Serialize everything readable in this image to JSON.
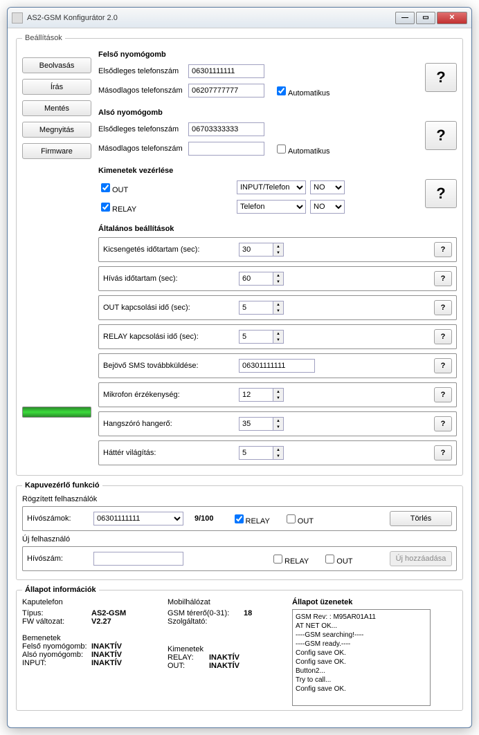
{
  "window": {
    "title": "AS2-GSM Konfigurátor 2.0"
  },
  "main_legend": "Beállítások",
  "sidebar": {
    "read": "Beolvasás",
    "write": "Írás",
    "save": "Mentés",
    "open": "Megnyitás",
    "firmware": "Firmware"
  },
  "top_button": {
    "title": "Felső nyomógomb",
    "primary_label": "Elsődleges telefonszám",
    "primary_value": "06301111111",
    "secondary_label": "Másodlagos telefonszám",
    "secondary_value": "06207777777",
    "auto_label": "Automatikus",
    "auto_checked": true
  },
  "bottom_button": {
    "title": "Alsó nyomógomb",
    "primary_label": "Elsődleges telefonszám",
    "primary_value": "06703333333",
    "secondary_label": "Másodlagos telefonszám",
    "secondary_value": "",
    "auto_label": "Automatikus",
    "auto_checked": false
  },
  "outputs": {
    "title": "Kimenetek vezérlése",
    "out_label": "OUT",
    "out_checked": true,
    "out_mode": "INPUT/Telefon",
    "out_state": "NO",
    "relay_label": "RELAY",
    "relay_checked": true,
    "relay_mode": "Telefon",
    "relay_state": "NO"
  },
  "general": {
    "title": "Általános beállítások",
    "rows": [
      {
        "label": "Kicsengetés időtartam (sec):",
        "value": "30",
        "type": "spin"
      },
      {
        "label": "Hívás időtartam (sec):",
        "value": "60",
        "type": "spin"
      },
      {
        "label": "OUT kapcsolási idő (sec):",
        "value": "5",
        "type": "spin"
      },
      {
        "label": "RELAY kapcsolási idő (sec):",
        "value": "5",
        "type": "spin"
      },
      {
        "label": "Bejövő SMS továbbküldése:",
        "value": "06301111111",
        "type": "text"
      },
      {
        "label": "Mikrofon érzékenység:",
        "value": "12",
        "type": "spin"
      },
      {
        "label": "Hangszóró hangerő:",
        "value": "35",
        "type": "spin"
      },
      {
        "label": "Háttér világítás:",
        "value": "5",
        "type": "spin"
      }
    ]
  },
  "gate": {
    "title": "Kapuvezérlő funkció",
    "fixed_label": "Rögzített felhasználók",
    "numbers_label": "Hívószámok:",
    "number_value": "06301111111",
    "count": "9/100",
    "relay_label": "RELAY",
    "relay_checked": true,
    "out_label": "OUT",
    "out_checked": false,
    "delete": "Törlés",
    "new_label": "Új felhasználó",
    "number2_label": "Hívószám:",
    "number2_value": "",
    "relay2_checked": false,
    "out2_checked": false,
    "add": "Új hozzáadása"
  },
  "status": {
    "title": "Állapot információk",
    "phone": {
      "title": "Kaputelefon",
      "type_label": "Típus:",
      "type_value": "AS2-GSM",
      "fw_label": "FW változat:",
      "fw_value": "V2.27"
    },
    "net": {
      "title": "Mobilhálózat",
      "signal_label": "GSM térerő(0-31):",
      "signal_value": "18",
      "provider_label": "Szolgáltató:"
    },
    "inputs": {
      "title": "Bemenetek",
      "top_label": "Felső nyomógomb:",
      "top_value": "INAKTÍV",
      "bot_label": "Alsó nyomógomb:",
      "bot_value": "INAKTÍV",
      "in_label": "INPUT:",
      "in_value": "INAKTÍV"
    },
    "outputs": {
      "title": "Kimenetek",
      "relay_label": "RELAY:",
      "relay_value": "INAKTÍV",
      "out_label": "OUT:",
      "out_value": "INAKTÍV"
    },
    "msg_title": "Állapot üzenetek",
    "messages": "GSM Rev: : M95AR01A11\nAT NET OK...\n  ----GSM searching!----\n  ----GSM ready.----\nConfig save OK.\nConfig save OK.\nButton2...\nTry to call...\nConfig save OK."
  },
  "help": "?"
}
